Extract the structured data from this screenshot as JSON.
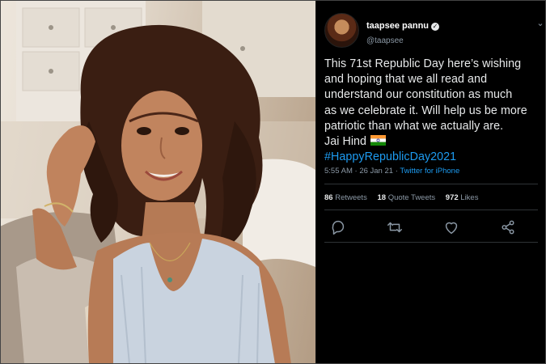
{
  "photo": {
    "subject": "photo-of-woman"
  },
  "tweet": {
    "display_name": "taapsee pannu",
    "handle": "@taapsee",
    "verified_icon": "verified-badge-icon",
    "lines": [
      "This 71st Republic Day here’s wishing",
      "and hoping that we all read and",
      "understand our constitution as much",
      "as we celebrate it. Will help us be more",
      "patriotic than what we actually are.",
      "Jai Hind"
    ],
    "hashtag": "#HappyRepublicDay2021",
    "time": "5:55 AM",
    "separator": "·",
    "date": "26 Jan 21",
    "source": "Twitter for iPhone",
    "stats": {
      "retweets_count": "86",
      "retweets_label": "Retweets",
      "quotes_count": "18",
      "quotes_label": "Quote Tweets",
      "likes_count": "972",
      "likes_label": "Likes"
    },
    "actions": [
      "reply-icon",
      "retweet-icon",
      "like-icon",
      "share-icon"
    ],
    "colors": {
      "background": "#000000",
      "text": "#e7e9ea",
      "muted": "#8b98a5",
      "link": "#1d9bf0"
    }
  }
}
